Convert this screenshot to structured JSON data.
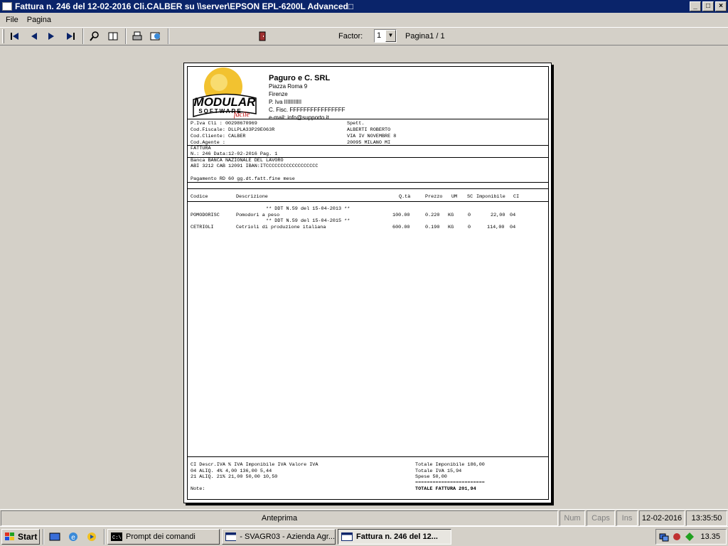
{
  "window": {
    "title": "Fattura n.  246 del 12-02-2016 Cli.CALBER su \\\\server\\EPSON EPL-6200L Advanced□",
    "controls": [
      "_",
      "□",
      "×"
    ]
  },
  "menu": [
    "File",
    "Pagina"
  ],
  "toolbar": {
    "factor_label": "Factor:",
    "factor_value": "1",
    "page_label": "Pagina1 / 1",
    "icons": [
      "first-page-icon",
      "prev-page-icon",
      "next-page-icon",
      "last-page-icon",
      "zoom-icon",
      "two-pages-icon",
      "print-icon",
      "export-icon",
      "exit-icon"
    ]
  },
  "invoice": {
    "logo_text": {
      "brand": "MODULAR",
      "sub": "SOFTWARE",
      "script": "facile"
    },
    "company": {
      "name": "Paguro e C. SRL",
      "address": "Piazza Roma 9",
      "city": "Firenze",
      "piva": "P. Iva  IIIIIIIIIII",
      "cf": "C. Fisc. FFFFFFFFFFFFFFFF",
      "email": "e-mail: info@supporto.it"
    },
    "client_left": [
      "P.Iva Cli  :  00298670969",
      "Cod.Fiscale: DLLPLA33P29E063R",
      "Cod.Cliente: CALBER",
      "Cod.Agente :"
    ],
    "client_right": [
      "Spett.",
      "ALBERTI ROBERTO",
      "VIA IV NOVEMBRE 8",
      "20095 MILANO MI"
    ],
    "doc": [
      "FATTURA",
      "N.:  246 Data:12-02-2016   Pag.  1"
    ],
    "bank": [
      "Banca  BANCA NAZIONALE DEL LAVORO",
      "  ABI  3212    CAB  12091         IBAN:ITCCCCCCCCCCCCCCCCCC",
      "",
      "Pagamento  RD 60 gg.dt.fatt.fine mese"
    ],
    "columns": {
      "codice": "Codice",
      "descrizione": "Descrizione",
      "qta": "Q.tà",
      "prezzo": "Prezzo",
      "um": "UM",
      "sc": "SC",
      "imponibile": "Imponibile",
      "ci": "CI"
    },
    "ddt": [
      "** DDT N.59 del 15-04-2013 **",
      "** DDT N.59 del 15-04-2015 **"
    ],
    "rows": [
      {
        "codice": "POMODORISC",
        "descrizione": "Pomodori a peso",
        "qta": "100.00",
        "prezzo": "0.220",
        "um": "KG",
        "sc": "0",
        "imponibile": "22,00",
        "ci": "04"
      },
      {
        "codice": "CETRIOLI",
        "descrizione": "Cetrioli di produzione italiana",
        "qta": "600.00",
        "prezzo": "0.190",
        "um": "KG",
        "sc": "0",
        "imponibile": "114,00",
        "ci": "04"
      }
    ],
    "footer_left": [
      "CI  Descr.IVA        % IVA   Imponibile IVA    Valore IVA",
      "04  ALIQ. 4%          4,00          136,00          5,44",
      "21  ALIQ. 21%        21,00           50,00         10,50",
      "",
      "Note:"
    ],
    "footer_right": [
      "Totale Imponibile          186,00",
      "Totale IVA                  15,94",
      "Spese          50,00",
      "========================",
      "TOTALE FATTURA              201,94"
    ]
  },
  "status": {
    "preview": "Anteprima",
    "num": "Num",
    "caps": "Caps",
    "ins": "Ins",
    "date": "12-02-2016",
    "time": "13:35:50"
  },
  "taskbar": {
    "start": "Start",
    "tasks": [
      "Prompt dei comandi",
      "- SVAGR03 - Azienda Agr...",
      "Fattura n.  246 del 12..."
    ],
    "clock": "13.35"
  }
}
